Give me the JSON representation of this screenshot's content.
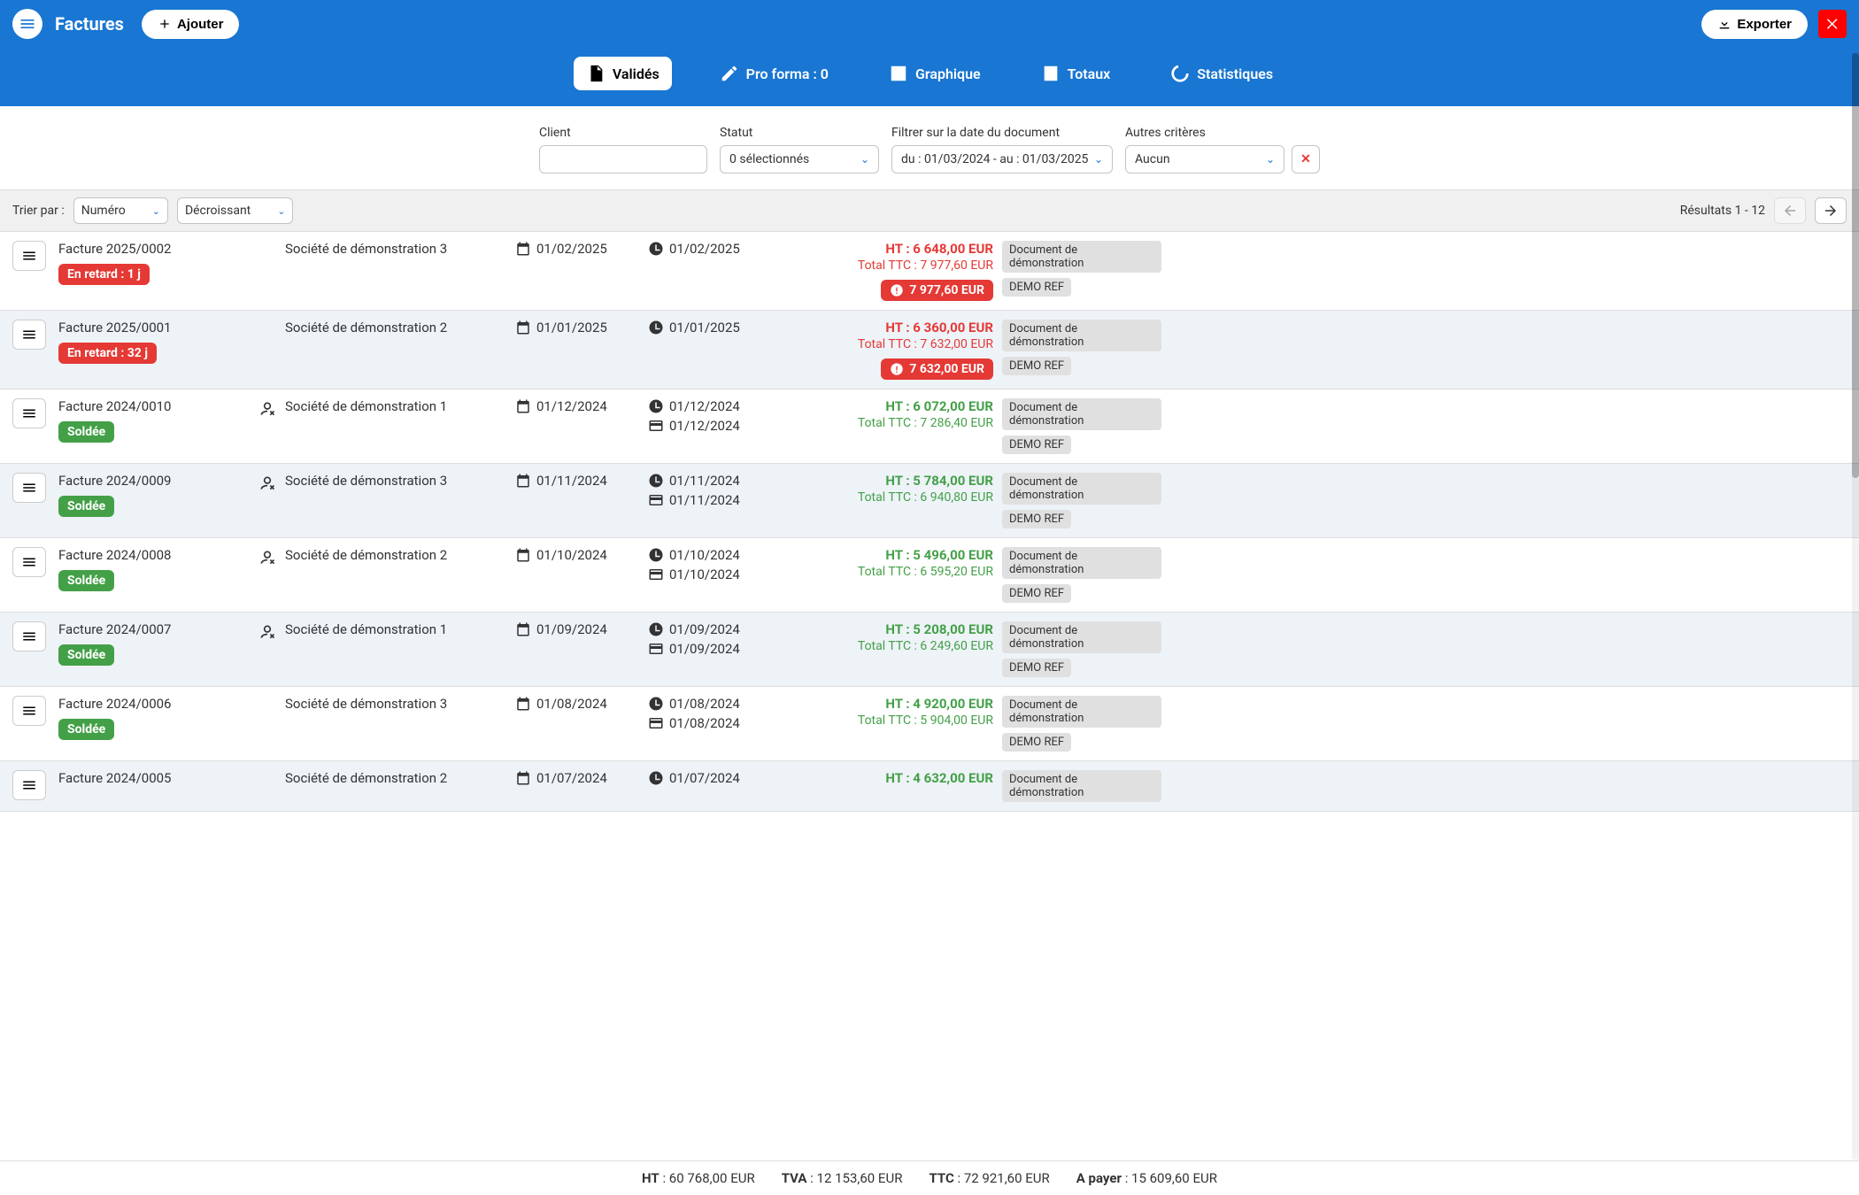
{
  "header": {
    "title": "Factures",
    "add_label": "Ajouter",
    "export_label": "Exporter"
  },
  "tabs": {
    "valides": "Validés",
    "proforma": "Pro forma : 0",
    "graphique": "Graphique",
    "totaux": "Totaux",
    "stats": "Statistiques"
  },
  "filters": {
    "client_label": "Client",
    "statut_label": "Statut",
    "statut_value": "0 sélectionnés",
    "date_label": "Filtrer sur la date du document",
    "date_value": "du : 01/03/2024 - au : 01/03/2025",
    "autres_label": "Autres critères",
    "autres_value": "Aucun"
  },
  "toolbar": {
    "sort_label": "Trier par :",
    "sort_field": "Numéro",
    "sort_dir": "Décroissant",
    "results": "Résultats 1 - 12"
  },
  "rows": [
    {
      "name": "Facture 2025/0002",
      "status": "late",
      "status_text": "En retard : 1 j",
      "client": "Société de démonstration 3",
      "date1": "01/02/2025",
      "date2a": "01/02/2025",
      "ht": "HT : 6 648,00 EUR",
      "ttc": "Total TTC : 7 977,60 EUR",
      "amt_color": "red",
      "alert": "7 977,60 EUR",
      "tag1": "Document de démonstration",
      "tag2": "DEMO REF",
      "sign": false,
      "pay_date": ""
    },
    {
      "name": "Facture 2025/0001",
      "status": "late",
      "status_text": "En retard : 32 j",
      "client": "Société de démonstration 2",
      "date1": "01/01/2025",
      "date2a": "01/01/2025",
      "ht": "HT : 6 360,00 EUR",
      "ttc": "Total TTC : 7 632,00 EUR",
      "amt_color": "red",
      "alert": "7 632,00 EUR",
      "tag1": "Document de démonstration",
      "tag2": "DEMO REF",
      "sign": false,
      "pay_date": ""
    },
    {
      "name": "Facture 2024/0010",
      "status": "paid",
      "status_text": "Soldée",
      "client": "Société de démonstration 1",
      "date1": "01/12/2024",
      "date2a": "01/12/2024",
      "ht": "HT : 6 072,00 EUR",
      "ttc": "Total TTC : 7 286,40 EUR",
      "amt_color": "green",
      "alert": "",
      "tag1": "Document de démonstration",
      "tag2": "DEMO REF",
      "sign": true,
      "pay_date": "01/12/2024"
    },
    {
      "name": "Facture 2024/0009",
      "status": "paid",
      "status_text": "Soldée",
      "client": "Société de démonstration 3",
      "date1": "01/11/2024",
      "date2a": "01/11/2024",
      "ht": "HT : 5 784,00 EUR",
      "ttc": "Total TTC : 6 940,80 EUR",
      "amt_color": "green",
      "alert": "",
      "tag1": "Document de démonstration",
      "tag2": "DEMO REF",
      "sign": true,
      "pay_date": "01/11/2024"
    },
    {
      "name": "Facture 2024/0008",
      "status": "paid",
      "status_text": "Soldée",
      "client": "Société de démonstration 2",
      "date1": "01/10/2024",
      "date2a": "01/10/2024",
      "ht": "HT : 5 496,00 EUR",
      "ttc": "Total TTC : 6 595,20 EUR",
      "amt_color": "green",
      "alert": "",
      "tag1": "Document de démonstration",
      "tag2": "DEMO REF",
      "sign": true,
      "pay_date": "01/10/2024"
    },
    {
      "name": "Facture 2024/0007",
      "status": "paid",
      "status_text": "Soldée",
      "client": "Société de démonstration 1",
      "date1": "01/09/2024",
      "date2a": "01/09/2024",
      "ht": "HT : 5 208,00 EUR",
      "ttc": "Total TTC : 6 249,60 EUR",
      "amt_color": "green",
      "alert": "",
      "tag1": "Document de démonstration",
      "tag2": "DEMO REF",
      "sign": true,
      "pay_date": "01/09/2024"
    },
    {
      "name": "Facture 2024/0006",
      "status": "paid",
      "status_text": "Soldée",
      "client": "Société de démonstration 3",
      "date1": "01/08/2024",
      "date2a": "01/08/2024",
      "ht": "HT : 4 920,00 EUR",
      "ttc": "Total TTC : 5 904,00 EUR",
      "amt_color": "green",
      "alert": "",
      "tag1": "Document de démonstration",
      "tag2": "DEMO REF",
      "sign": false,
      "pay_date": "01/08/2024"
    },
    {
      "name": "Facture 2024/0005",
      "status": "paid",
      "status_text": "",
      "client": "Société de démonstration 2",
      "date1": "01/07/2024",
      "date2a": "01/07/2024",
      "ht": "HT : 4 632,00 EUR",
      "ttc": "",
      "amt_color": "green",
      "alert": "",
      "tag1": "Document de démonstration",
      "tag2": "",
      "sign": false,
      "pay_date": ""
    }
  ],
  "footer": {
    "ht_label": "HT",
    "ht_value": "60 768,00 EUR",
    "tva_label": "TVA",
    "tva_value": "12 153,60 EUR",
    "ttc_label": "TTC",
    "ttc_value": "72 921,60 EUR",
    "apayer_label": "A payer",
    "apayer_value": "15 609,60 EUR"
  }
}
